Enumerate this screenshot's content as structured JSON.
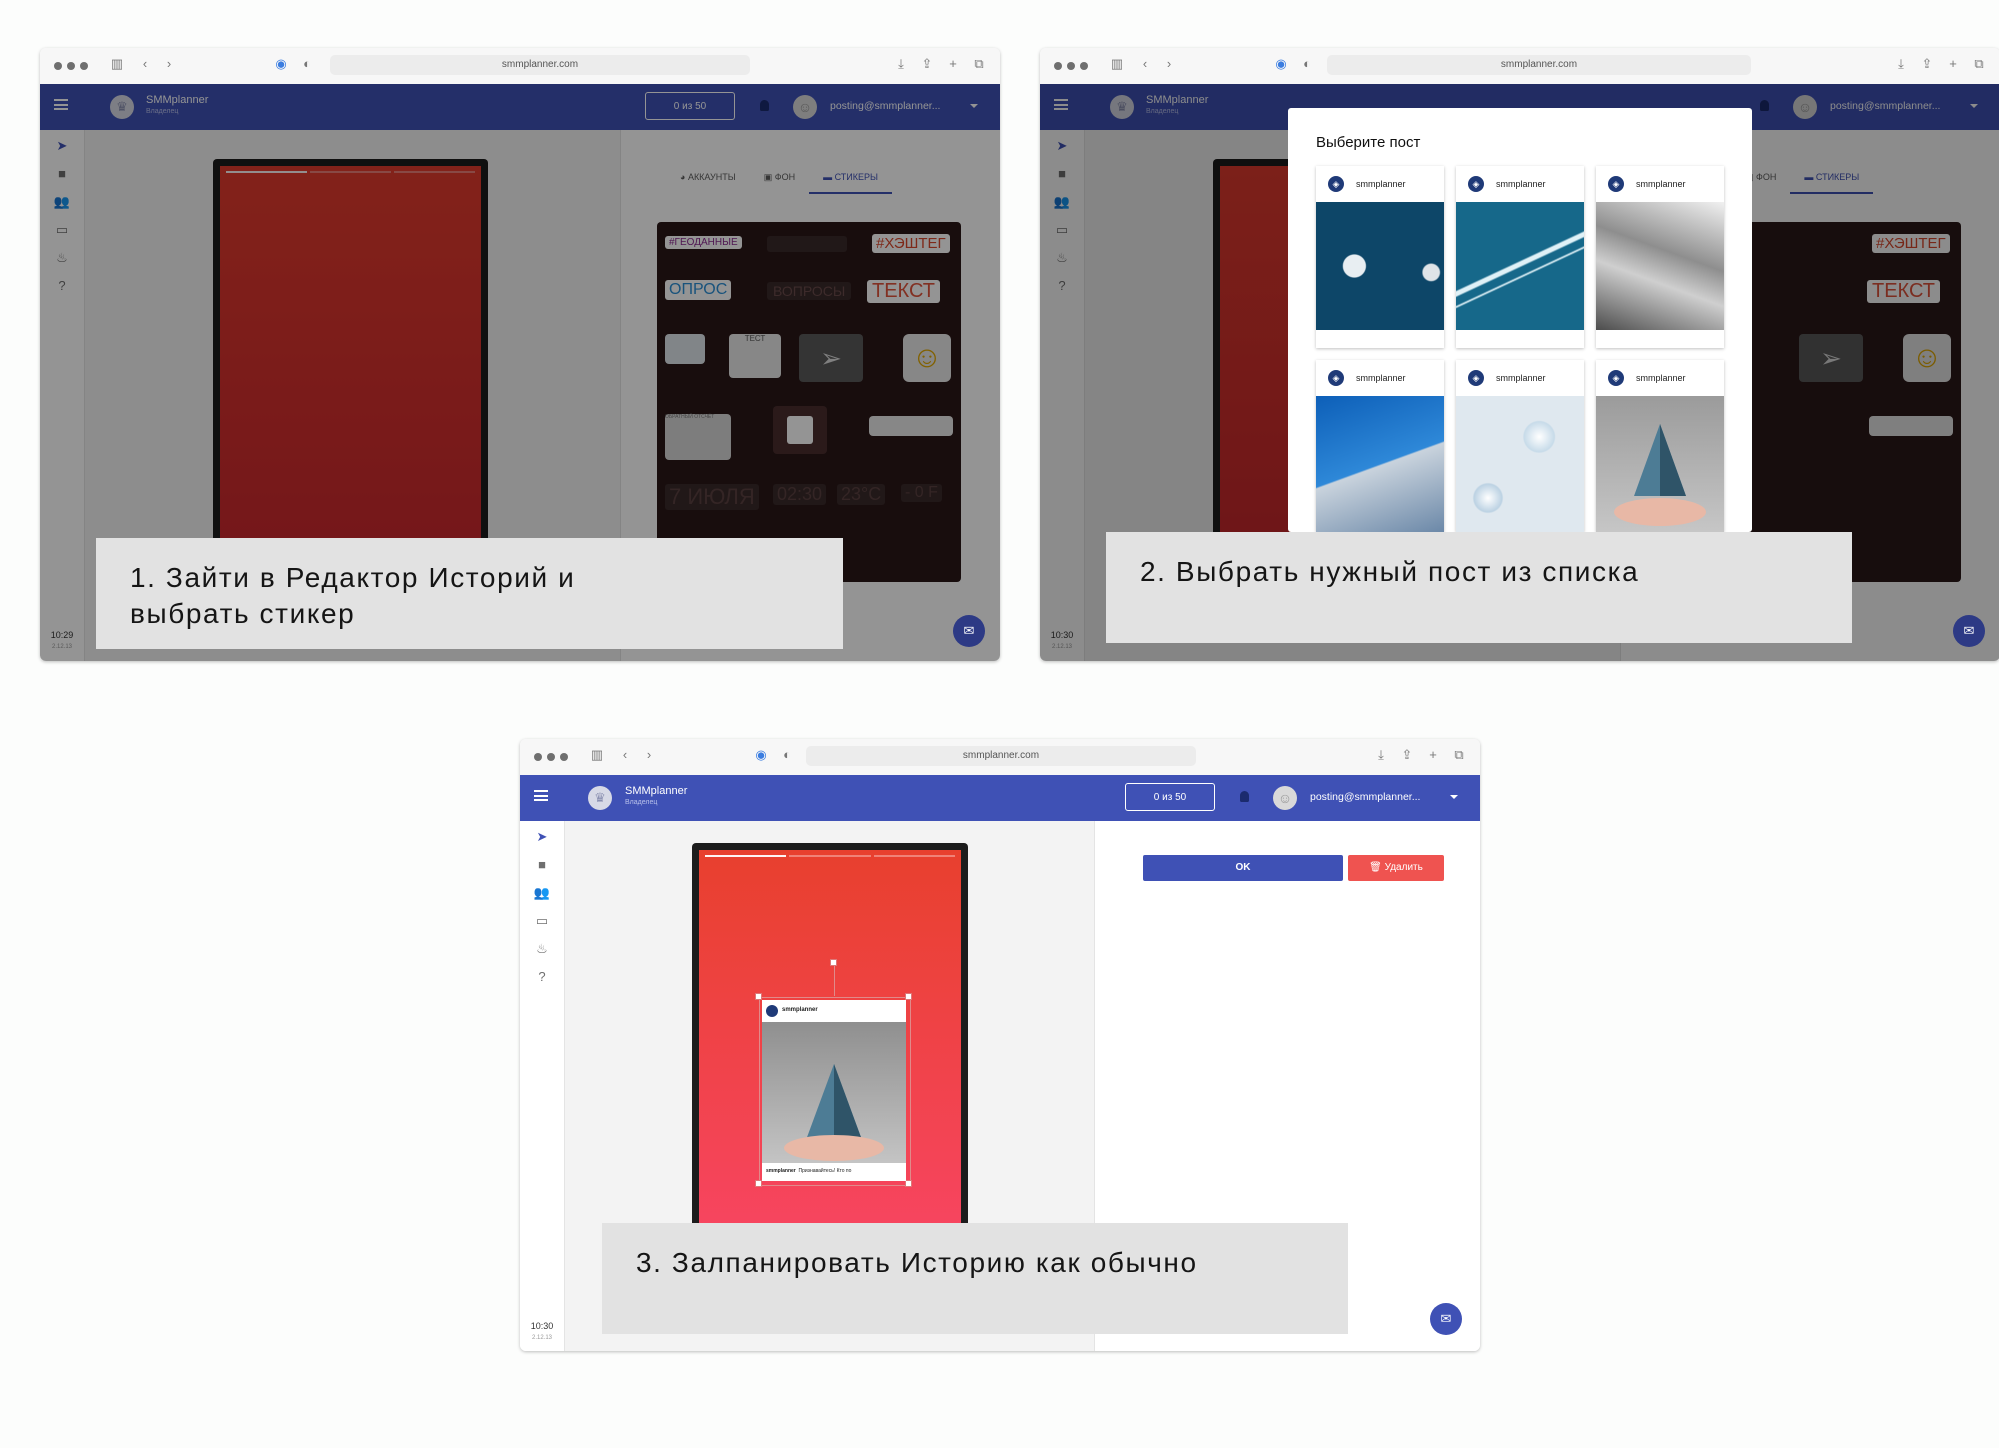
{
  "browser": {
    "url": "smmplanner.com"
  },
  "app": {
    "brand": "SMMplanner",
    "role": "Владелец",
    "counter": "0 из 50",
    "email": "posting@smmplanner...",
    "sidebar_icons": [
      "send-icon",
      "folder-icon",
      "people-icon",
      "card-icon",
      "fire-icon",
      "help-icon"
    ]
  },
  "panel1": {
    "time": "10:29",
    "version": "2.12.13",
    "tabs": [
      "АККАУНТЫ",
      "ФОН",
      "СТИКЕРЫ"
    ],
    "stickers": {
      "geo": "#ГЕОДАННЫЕ",
      "hashtag": "#ХЭШТЕГ",
      "poll": "ОПРОС",
      "questions": "ВОПРОСЫ",
      "text": "ТЕКСТ",
      "test": "ТЕСТ",
      "countdown": "ОБРАТНЫЙ ОТСЧЁТ",
      "date": "7 ИЮЛЯ",
      "clock": "02:30",
      "temp": "23°C",
      "temp2": "- 0 F"
    },
    "caption": [
      "1. Зайти в Редактор Историй и",
      "выбрать стикер"
    ]
  },
  "panel2": {
    "time": "10:30",
    "version": "2.12.13",
    "tabs": [
      "ФОН",
      "СТИКЕРЫ"
    ],
    "modal_title": "Выберите пост",
    "posts": [
      {
        "account": "smmplanner",
        "image": "paper-ball-dark-blue"
      },
      {
        "account": "smmplanner",
        "image": "contrails-blue-sky"
      },
      {
        "account": "smmplanner",
        "image": "newspaper-boat"
      },
      {
        "account": "smmplanner",
        "image": "paper-plane-building"
      },
      {
        "account": "smmplanner",
        "image": "paper-balls-light"
      },
      {
        "account": "smmplanner",
        "image": "hands-paper-pyramid"
      }
    ],
    "caption": "2. Выбрать нужный пост из списка"
  },
  "panel3": {
    "time": "10:30",
    "version": "2.12.13",
    "ok_label": "OK",
    "delete_label": "Удалить",
    "post_account": "smmplanner",
    "post_footer_user": "smmplanner",
    "post_footer_text": "Признавайтесь! Кто по",
    "caption": "3. Залпанировать Историю как обычно"
  },
  "colors": {
    "appbar": "#3f51b5",
    "accent": "#3f51b5",
    "delete": "#ef5350",
    "story_top": "#e8402e",
    "story_bottom": "#f74560"
  }
}
